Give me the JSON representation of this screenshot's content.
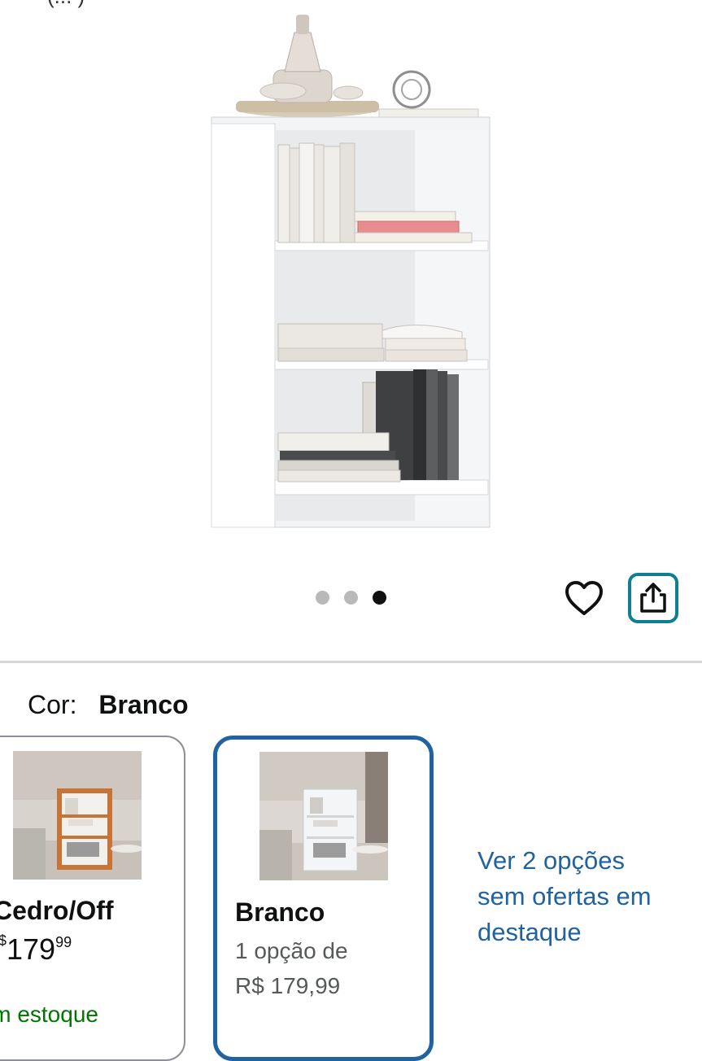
{
  "product": {
    "top_cropped_text": "(... )",
    "image_alt": "Estante branca com três prateleiras e livros",
    "carousel": {
      "count": 3,
      "active_index": 2
    },
    "actions": {
      "favorite_icon": "heart-icon",
      "share_icon": "share-icon"
    }
  },
  "variation": {
    "label": "Cor:",
    "selected_value": "Branco",
    "options": [
      {
        "name": "Cedro/Off",
        "price_currency": "R$",
        "price_whole": "179",
        "price_cents": "99",
        "availability": "Em estoque",
        "availability_visible": "im estoque",
        "name_visible": "Cedro/Off",
        "selected": false
      },
      {
        "name": "Branco",
        "offer_line1": "1 opção de",
        "offer_line2": "R$ 179,99",
        "selected": true
      }
    ],
    "more_link": "Ver 2 opções sem ofertas em destaque"
  },
  "colors": {
    "accent_selected_border": "#2162a1",
    "share_border": "#0f7f91",
    "link": "#2162a1",
    "stock_green": "#007600"
  }
}
